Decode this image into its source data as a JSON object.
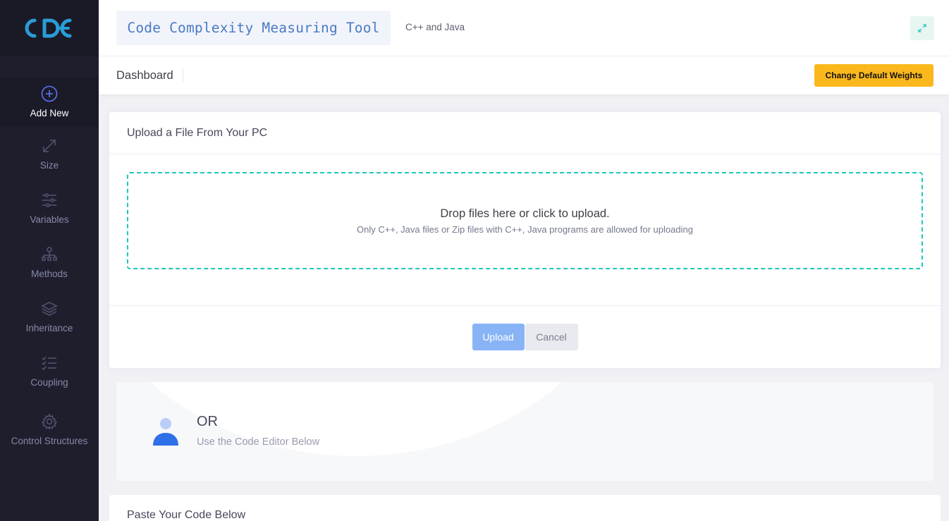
{
  "app": {
    "logo_text": "CDE",
    "title": "Code Complexity Measuring Tool",
    "subtitle": "C++ and Java"
  },
  "colors": {
    "sidebar_bg": "#1e1e2d",
    "accent_blue": "#4a7ac4",
    "dropzone_border": "#1dc9b7",
    "weights_button": "#fbb81d",
    "upload_button": "#88b4f6"
  },
  "sidebar": {
    "items": [
      {
        "label": "Add New",
        "icon": "plus-circle-icon",
        "active": true
      },
      {
        "label": "Size",
        "icon": "expand-arrows-icon"
      },
      {
        "label": "Variables",
        "icon": "sliders-icon"
      },
      {
        "label": "Methods",
        "icon": "sitemap-icon"
      },
      {
        "label": "Inheritance",
        "icon": "layers-icon"
      },
      {
        "label": "Coupling",
        "icon": "checklist-icon"
      },
      {
        "label": "Control Structures",
        "icon": "gear-icon"
      }
    ]
  },
  "subheader": {
    "title": "Dashboard",
    "weights_button": "Change Default Weights"
  },
  "upload": {
    "title": "Upload a File From Your PC",
    "drop_main": "Drop files here or click to upload.",
    "drop_sub": "Only C++, Java files or Zip files with C++, Java programs are allowed for uploading",
    "upload_label": "Upload",
    "cancel_label": "Cancel"
  },
  "or_section": {
    "title": "OR",
    "subtitle": "Use the Code Editor Below"
  },
  "paste": {
    "title": "Paste Your Code Below"
  }
}
